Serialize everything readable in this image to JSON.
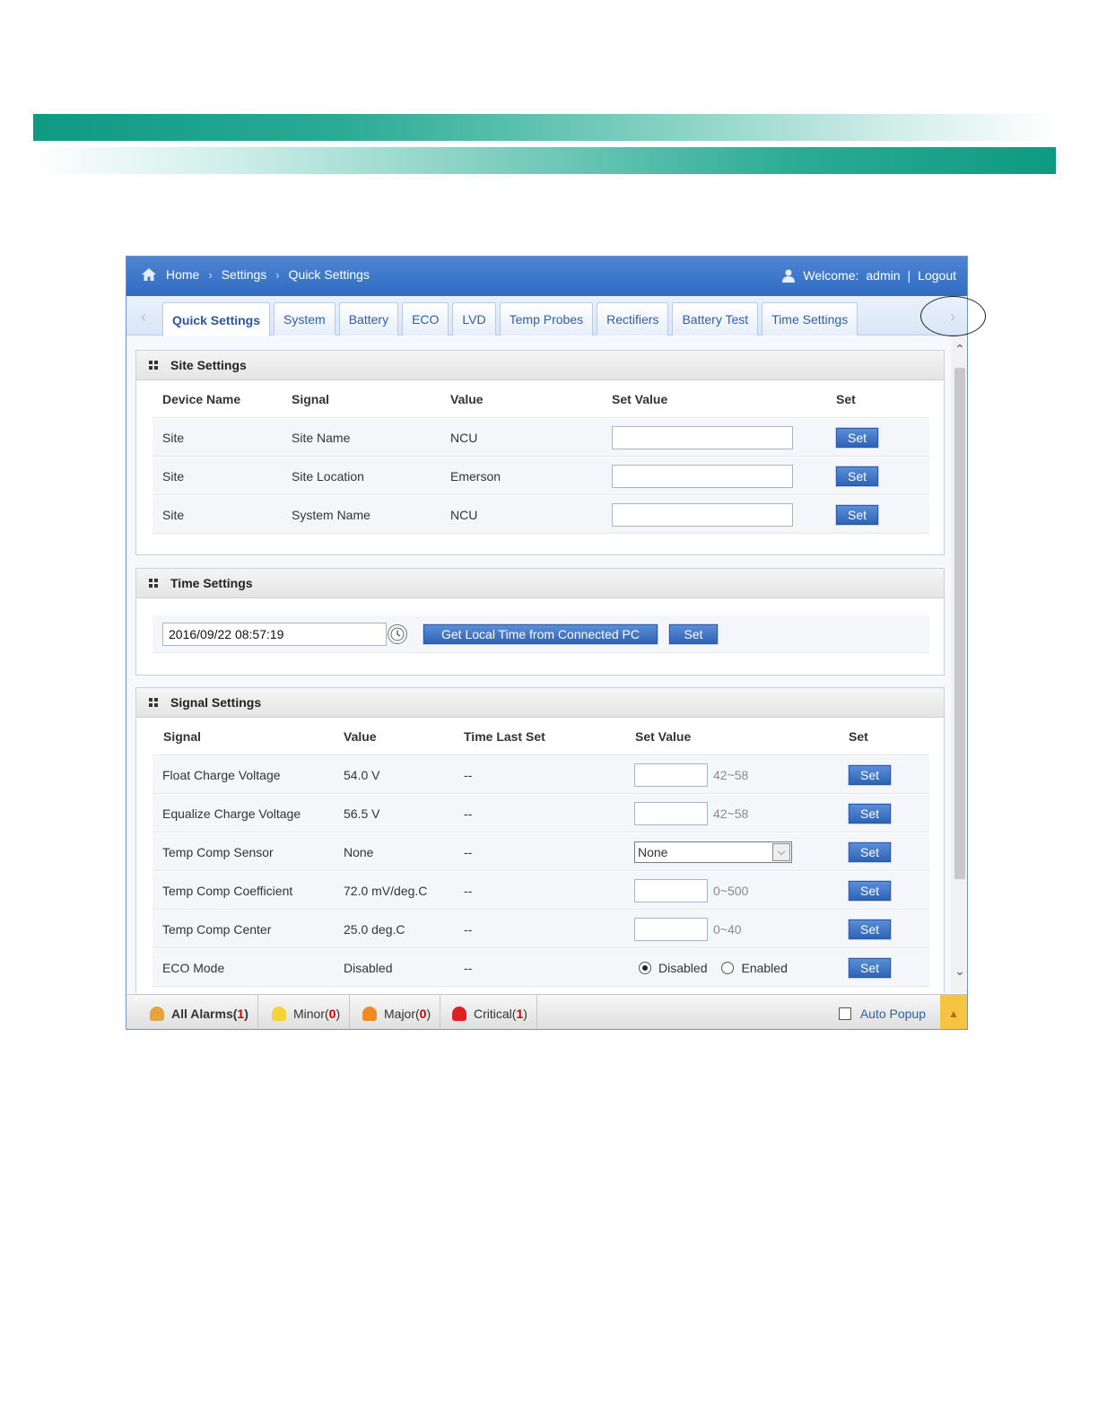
{
  "breadcrumb": [
    "Home",
    "Settings",
    "Quick Settings"
  ],
  "user": {
    "welcome": "Welcome:",
    "name": "admin",
    "divider": "|",
    "logout": "Logout"
  },
  "tabs": [
    "Quick Settings",
    "System",
    "Battery",
    "ECO",
    "LVD",
    "Temp Probes",
    "Rectifiers",
    "Battery Test",
    "Time Settings"
  ],
  "site_settings": {
    "title": "Site Settings",
    "headers": [
      "Device Name",
      "Signal",
      "Value",
      "Set Value",
      "Set"
    ],
    "rows": [
      {
        "device": "Site",
        "signal": "Site Name",
        "value": "NCU",
        "set": "Set"
      },
      {
        "device": "Site",
        "signal": "Site Location",
        "value": "Emerson",
        "set": "Set"
      },
      {
        "device": "Site",
        "signal": "System Name",
        "value": "NCU",
        "set": "Set"
      }
    ]
  },
  "time_settings": {
    "title": "Time Settings",
    "datetime": "2016/09/22 08:57:19",
    "get_local_btn": "Get Local Time from Connected PC",
    "set_btn": "Set"
  },
  "signal_settings": {
    "title": "Signal Settings",
    "headers": [
      "Signal",
      "Value",
      "Time Last Set",
      "Set Value",
      "Set"
    ],
    "rows": [
      {
        "signal": "Float Charge Voltage",
        "value": "54.0 V",
        "time": "--",
        "range": "42~58",
        "set": "Set"
      },
      {
        "signal": "Equalize Charge Voltage",
        "value": "56.5 V",
        "time": "--",
        "range": "42~58",
        "set": "Set"
      },
      {
        "signal": "Temp Comp Sensor",
        "value": "None",
        "time": "--",
        "select": "None",
        "set": "Set"
      },
      {
        "signal": "Temp Comp Coefficient",
        "value": "72.0 mV/deg.C",
        "time": "--",
        "range": "0~500",
        "set": "Set"
      },
      {
        "signal": "Temp Comp Center",
        "value": "25.0 deg.C",
        "time": "--",
        "range": "0~40",
        "set": "Set"
      },
      {
        "signal": "ECO Mode",
        "value": "Disabled",
        "time": "--",
        "radio_disabled": "Disabled",
        "radio_enabled": "Enabled",
        "set": "Set"
      }
    ]
  },
  "alarms": {
    "all": {
      "label": "All Alarms(",
      "count": "1",
      "close": ")"
    },
    "minor": {
      "label": "Minor(",
      "count": "0",
      "close": ")"
    },
    "major": {
      "label": "Major(",
      "count": "0",
      "close": ")"
    },
    "critical": {
      "label": "Critical(",
      "count": "1",
      "close": ")"
    },
    "auto_popup": "Auto Popup"
  },
  "icons": {
    "home": "home-icon",
    "user": "user-icon",
    "clock": "clock-icon",
    "bell_all": "alarm-bell-icon",
    "bell_minor": "minor-bell-icon",
    "bell_major": "major-bell-icon",
    "bell_critical": "critical-siren-icon"
  },
  "colors": {
    "topbar": "#2f6cc2",
    "button": "#2f63b5",
    "band": "#0e9a82",
    "alarm_count": "#d00000"
  }
}
